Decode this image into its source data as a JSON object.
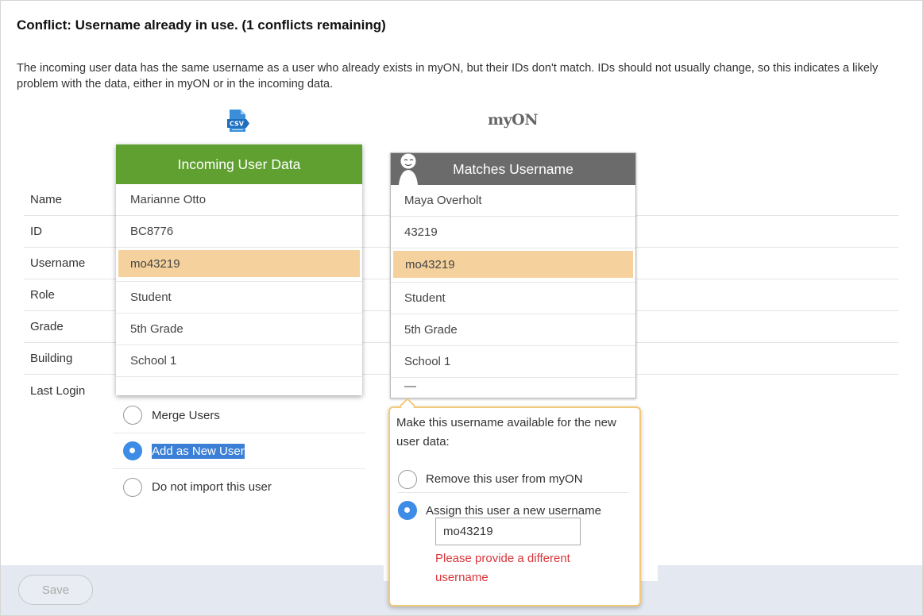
{
  "title": "Conflict: Username already in use. (1 conflicts remaining)",
  "description": "The incoming user data has the same username as a user who already exists in myON, but their IDs don't match. IDs should not usually change, so this indicates a likely problem with the data, either in myON or in the incoming data.",
  "csv_icon_label": "CSV",
  "myon_logo": "myON",
  "row_labels": [
    "Name",
    "ID",
    "Username",
    "Role",
    "Grade",
    "Building",
    "Last Login"
  ],
  "incoming": {
    "header": "Incoming User Data",
    "name": "Marianne Otto",
    "id": "BC8776",
    "username": "mo43219",
    "role": "Student",
    "grade": "5th Grade",
    "building": "School 1",
    "last_login": ""
  },
  "existing": {
    "header": "Matches Username",
    "name": "Maya Overholt",
    "id": "43219",
    "username": "mo43219",
    "role": "Student",
    "grade": "5th Grade",
    "building": "School 1",
    "last_login": "—"
  },
  "actions": {
    "merge": "Merge Users",
    "add_new": "Add as New User",
    "do_not_import": "Do not import this user",
    "selected": "add_new"
  },
  "popover": {
    "title": "Make this username available for the new user data:",
    "remove_option": "Remove this user from myON",
    "assign_option": "Assign this user a new username",
    "new_username_value": "mo43219",
    "error": "Please provide a different username"
  },
  "footer": {
    "save_label": "Save"
  },
  "colors": {
    "incoming_header": "#5fa030",
    "existing_header": "#6b6b6b",
    "highlight": "#f5d29d",
    "radio_selected": "#3d8de6",
    "popover_border": "#f2c879",
    "error": "#d9363a"
  }
}
